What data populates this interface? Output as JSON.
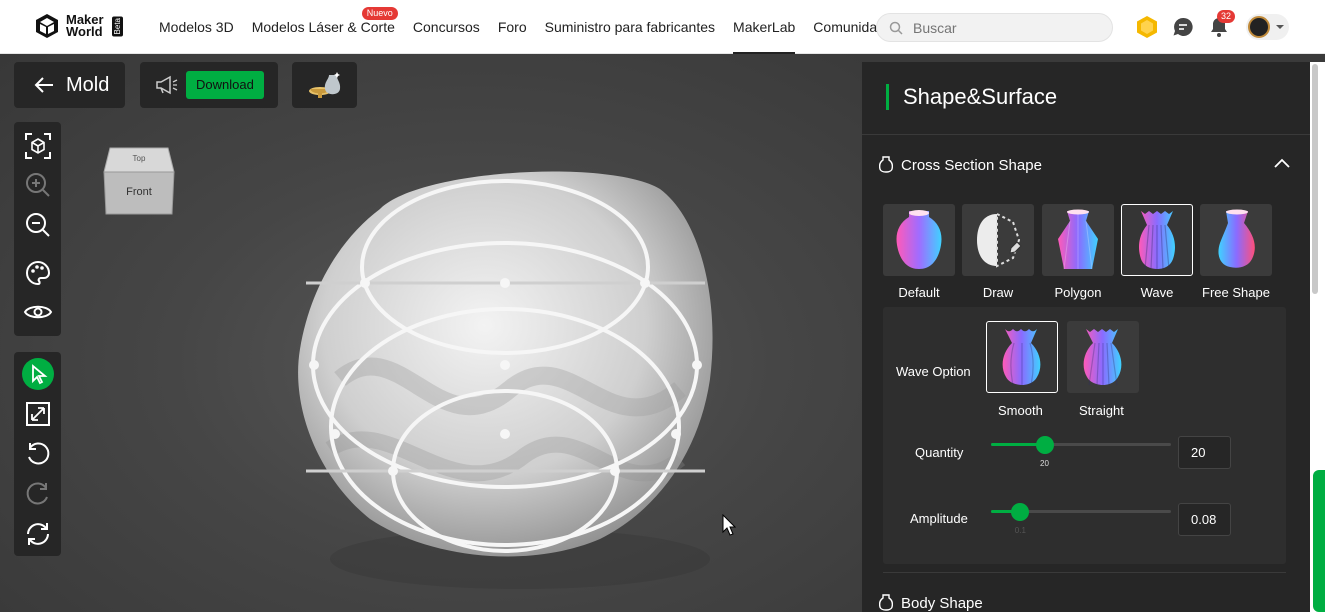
{
  "brand": {
    "line1": "Maker",
    "line2": "World",
    "beta": "Beta"
  },
  "nav": {
    "items": [
      "Modelos 3D",
      "Modelos Láser & Corte",
      "Concursos",
      "Foro",
      "Suministro para fabricantes",
      "MakerLab",
      "Comunidad"
    ],
    "new_badge": "Nuevo",
    "active": "MakerLab"
  },
  "search": {
    "placeholder": "Buscar"
  },
  "notifications": {
    "count": "32"
  },
  "workspace": {
    "back_label": "Mold",
    "download_label": "Download",
    "cube_top": "Top",
    "cube_front": "Front"
  },
  "panel": {
    "title": "Shape&Surface",
    "section_cross": "Cross Section Shape",
    "shapes": [
      "Default",
      "Draw",
      "Polygon",
      "Wave",
      "Free Shape"
    ],
    "selected_shape": "Wave",
    "wave_option_label": "Wave Option",
    "wave_options": [
      "Smooth",
      "Straight"
    ],
    "selected_wave_option": "Smooth",
    "quantity": {
      "label": "Quantity",
      "value": "20",
      "tick": "20",
      "fraction": 0.3
    },
    "amplitude": {
      "label": "Amplitude",
      "value": "0.08",
      "tick": "0.1",
      "fraction": 0.16
    },
    "section_body": "Body Shape"
  },
  "colors": {
    "accent": "#00ae42",
    "panel_bg": "#262626",
    "badge": "#e53935"
  }
}
